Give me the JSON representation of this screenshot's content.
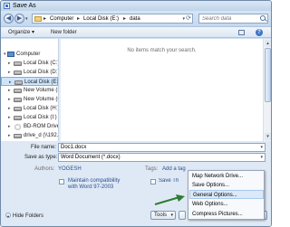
{
  "window": {
    "title": "Save As"
  },
  "address": {
    "crumbs": [
      "Computer",
      "Local Disk (E:)",
      "data"
    ],
    "separator": "▸"
  },
  "search": {
    "placeholder": "Search data"
  },
  "toolbar": {
    "organize": "Organize ▾",
    "new_folder": "New folder"
  },
  "nav": {
    "items": [
      {
        "label": "Computer",
        "type": "computer"
      },
      {
        "label": "Local Disk (C:)",
        "type": "drive"
      },
      {
        "label": "Local Disk (D:)",
        "type": "drive"
      },
      {
        "label": "Local Disk (E:)",
        "type": "drive",
        "selected": true
      },
      {
        "label": "New Volume (F:)",
        "type": "drive"
      },
      {
        "label": "New Volume (G:)",
        "type": "drive"
      },
      {
        "label": "Local Disk (H:)",
        "type": "drive"
      },
      {
        "label": "Local Disk (I:)",
        "type": "drive"
      },
      {
        "label": "BD-ROM Drive (J:)",
        "type": "dvd"
      },
      {
        "label": "drive_d (\\\\192.1",
        "type": "drive"
      }
    ]
  },
  "files": {
    "empty_message": "No items match your search."
  },
  "form": {
    "file_name_label": "File name:",
    "file_name_value": "Doc1.docx",
    "save_type_label": "Save as type:",
    "save_type_value": "Word Document (*.docx)",
    "authors_label": "Authors:",
    "authors_value": "YOGESH",
    "tags_label": "Tags:",
    "tags_value": "Add a tag",
    "maintain_label": "Maintain compatibility with Word 97-2003",
    "save_thumbnail_label": "Save Th"
  },
  "footer": {
    "hide_folders": "Hide Folders",
    "tools": "Tools"
  },
  "tools_menu": {
    "items": [
      {
        "label": "Map Network Drive..."
      },
      {
        "label": "Save Options..."
      },
      {
        "label": "General Options...",
        "highlighted": true
      },
      {
        "label": "Web Options..."
      },
      {
        "label": "Compress Pictures..."
      }
    ]
  },
  "colors": {
    "annotation_arrow": "#2e7d32",
    "accent": "#3d76c8"
  }
}
